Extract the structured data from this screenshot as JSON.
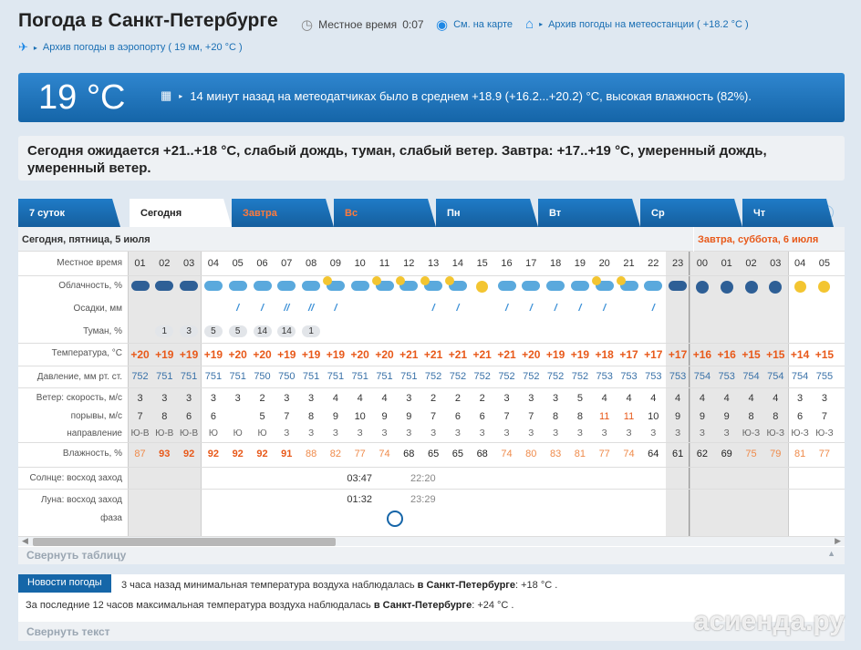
{
  "header": {
    "title": "Погода в Санкт-Петербурге",
    "local_time_label": "Местное время",
    "local_time": "0:07",
    "map_link": "См. на карте",
    "archive_link": "Архив погоды на метеостанции ( +18.2 °C )",
    "airport_link": "Архив погоды в аэропорту ( 19 км, +20 °C )"
  },
  "current": {
    "temperature": "19 °C",
    "description": "14 минут назад на метеодатчиках было в среднем +18.9 (+16.2...+20.2) °C, высокая влажность (82%)."
  },
  "forecast_text": "Сегодня ожидается +21..+18 °C, слабый дождь, туман, слабый ветер. Завтра: +17..+19 °C, умеренный дождь, умеренный ветер.",
  "tabs": [
    "7 суток",
    "Сегодня",
    "Завтра",
    "Вс",
    "Пн",
    "Вт",
    "Ср",
    "Чт"
  ],
  "help_glyph": "?",
  "table": {
    "today_header": "Сегодня, пятница, 5 июля",
    "tomorrow_header": "Завтра, суббота, 6 июля",
    "labels": {
      "time": "Местное время",
      "cloud": "Облачность, %",
      "precip": "Осадки, мм",
      "fog": "Туман, %",
      "temp": "Температура, °C",
      "pressure": "Давление, мм рт. ст.",
      "wind_speed": "Ветер: скорость, м/с",
      "gusts": "порывы, м/с",
      "direction": "направление",
      "humidity": "Влажность, %",
      "sun": "Солнце: восход заход",
      "moon": "Луна: восход заход",
      "phase": "фаза"
    },
    "hours": [
      "01",
      "02",
      "03",
      "04",
      "05",
      "06",
      "07",
      "08",
      "09",
      "10",
      "11",
      "12",
      "13",
      "14",
      "15",
      "16",
      "17",
      "18",
      "19",
      "20",
      "21",
      "22",
      "23",
      "00",
      "01",
      "02",
      "03",
      "04",
      "05"
    ],
    "cloud_icons": [
      "night-cloud-rain-icon",
      "night-cloud-rain-icon",
      "night-cloud-icon",
      "cloud-rain-icon",
      "cloud-rain-icon",
      "cloud-rain-icon",
      "cloud-rain-icon",
      "cloud-rain-icon",
      "sun-cloud-icon",
      "cloud-rain-icon",
      "sun-cloud-icon",
      "sun-cloud-icon",
      "sun-cloud-icon",
      "sun-cloud-icon",
      "sun-icon",
      "cloud-icon",
      "cloud-icon",
      "cloud-icon",
      "cloud-icon",
      "sun-cloud-icon",
      "sun-cloud-icon",
      "cloud-icon",
      "night-cloud-icon",
      "night-icon",
      "night-icon",
      "night-icon",
      "night-icon",
      "sun-icon",
      "sun-icon"
    ],
    "precip": [
      "",
      "",
      "",
      "",
      "",
      "",
      "",
      "",
      "",
      "",
      "",
      "",
      "",
      "",
      "",
      "",
      "",
      "",
      "",
      "",
      "",
      "",
      "",
      "",
      "",
      "",
      "",
      "",
      ""
    ],
    "precip_drops": [
      0,
      0,
      0,
      0,
      1,
      1,
      2,
      2,
      1,
      0,
      0,
      0,
      1,
      1,
      0,
      1,
      1,
      1,
      1,
      1,
      0,
      1,
      0,
      0,
      0,
      0,
      0,
      0,
      0
    ],
    "fog": [
      "",
      "1",
      "3",
      "5",
      "5",
      "14",
      "14",
      "1",
      "",
      "",
      "",
      "",
      "",
      "",
      "",
      "",
      "",
      "",
      "",
      "",
      "",
      "",
      "",
      "",
      "",
      "",
      "",
      "",
      ""
    ],
    "temperature": [
      "+20",
      "+19",
      "+19",
      "+19",
      "+20",
      "+20",
      "+19",
      "+19",
      "+19",
      "+20",
      "+20",
      "+21",
      "+21",
      "+21",
      "+21",
      "+21",
      "+20",
      "+19",
      "+19",
      "+18",
      "+17",
      "+17",
      "+17",
      "+16",
      "+16",
      "+15",
      "+15",
      "+14",
      "+15"
    ],
    "pressure": [
      "752",
      "751",
      "751",
      "751",
      "751",
      "750",
      "750",
      "751",
      "751",
      "751",
      "751",
      "751",
      "752",
      "752",
      "752",
      "752",
      "752",
      "752",
      "752",
      "753",
      "753",
      "753",
      "753",
      "754",
      "753",
      "754",
      "754",
      "754",
      "755"
    ],
    "wind_speed": [
      "3",
      "3",
      "3",
      "3",
      "3",
      "2",
      "3",
      "3",
      "4",
      "4",
      "4",
      "3",
      "2",
      "2",
      "2",
      "3",
      "3",
      "3",
      "5",
      "4",
      "4",
      "4",
      "4",
      "4",
      "4",
      "4",
      "4",
      "3",
      "3"
    ],
    "gusts": [
      "7",
      "8",
      "6",
      "6",
      "",
      "5",
      "7",
      "8",
      "9",
      "10",
      "9",
      "9",
      "7",
      "6",
      "6",
      "7",
      "7",
      "8",
      "8",
      "11",
      "11",
      "10",
      "9",
      "9",
      "9",
      "8",
      "8",
      "6",
      "7"
    ],
    "gusts_hot": [
      false,
      false,
      false,
      false,
      false,
      false,
      false,
      false,
      false,
      false,
      false,
      false,
      false,
      false,
      false,
      false,
      false,
      false,
      false,
      true,
      true,
      false,
      false,
      false,
      false,
      false,
      false,
      false,
      false
    ],
    "direction": [
      "Ю-В",
      "Ю-В",
      "Ю-В",
      "Ю",
      "Ю",
      "Ю",
      "З",
      "З",
      "З",
      "З",
      "З",
      "З",
      "З",
      "З",
      "З",
      "З",
      "З",
      "З",
      "З",
      "З",
      "З",
      "З",
      "З",
      "З",
      "З",
      "Ю-З",
      "Ю-З",
      "Ю-З",
      "Ю-З"
    ],
    "humidity": [
      "87",
      "93",
      "92",
      "92",
      "92",
      "92",
      "91",
      "88",
      "82",
      "77",
      "74",
      "68",
      "65",
      "65",
      "68",
      "74",
      "80",
      "83",
      "81",
      "77",
      "74",
      "64",
      "61",
      "62",
      "69",
      "75",
      "79",
      "81",
      "77"
    ],
    "sunrise": "03:47",
    "sunset": "22:20",
    "moonrise": "01:32",
    "moonset": "23:29"
  },
  "collapse_table": "Свернуть таблицу",
  "news": {
    "badge": "Новости погоды",
    "line1_pre": "3 часа назад минимальная температура воздуха наблюдалась",
    "line1_city": "в Санкт-Петербурге",
    "line1_post": ": +18 °С .",
    "line2_pre": "За последние 12 часов максимальная температура воздуха наблюдалась",
    "line2_city": "в Санкт-Петербурге",
    "line2_post": ": +24 °С .",
    "collapse": "Свернуть текст"
  },
  "watermark": "асиенда.ру",
  "colors": {
    "accent": "#1565a8",
    "hot": "#e8591a",
    "link": "#1a6fb4"
  }
}
